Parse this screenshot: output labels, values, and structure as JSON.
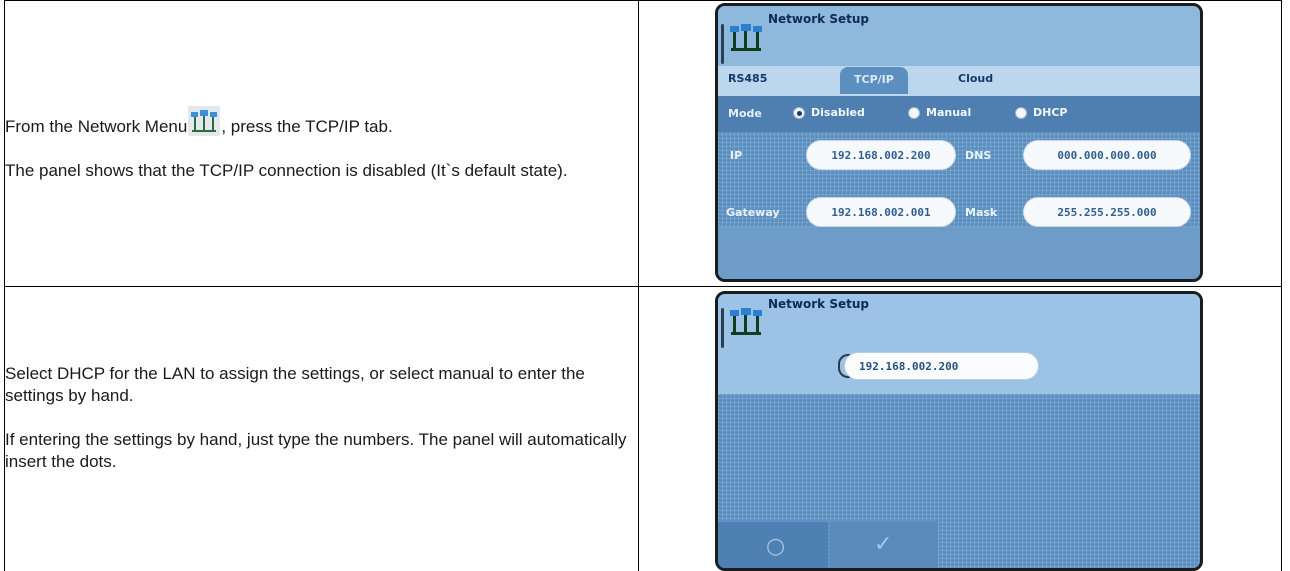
{
  "rows": [
    {
      "paragraphs": [
        {
          "before_icon": "From the Network Menu",
          "after_icon": ", press the TCP/IP tab."
        },
        {
          "text": "The panel shows that the TCP/IP connection is disabled (It`s default state)."
        }
      ]
    },
    {
      "paragraphs": [
        {
          "text": "Select DHCP for the LAN to assign the settings, or select manual to enter the settings by hand."
        },
        {
          "text": "If entering the settings by hand, just type the numbers. The panel will automatically insert the dots."
        }
      ]
    }
  ],
  "screen1": {
    "title": "Network Setup",
    "tabs": [
      "RS485",
      "TCP/IP",
      "Cloud"
    ],
    "active_tab": 1,
    "mode_label": "Mode",
    "mode_options": [
      "Disabled",
      "Manual",
      "DHCP"
    ],
    "selected_mode": 0,
    "fields": {
      "ip": {
        "label": "IP",
        "value": "192.168.002.200"
      },
      "dns": {
        "label": "DNS",
        "value": "000.000.000.000"
      },
      "gateway": {
        "label": "Gateway",
        "value": "192.168.002.001"
      },
      "mask": {
        "label": "Mask",
        "value": "255.255.255.000"
      }
    }
  },
  "screen2": {
    "title": "Network Setup",
    "edit_value": "192.168.002.200",
    "cancel_glyph": "○",
    "confirm_glyph": "✓"
  },
  "colors": {
    "screen_bg": "#5b8fbf",
    "header_bg": "#8fb8dd",
    "tab_strip": "#bcd6ee",
    "accent_text": "#0d2a55",
    "field_text": "#2f5e92"
  },
  "icons": {
    "network": "network-menu-icon"
  }
}
